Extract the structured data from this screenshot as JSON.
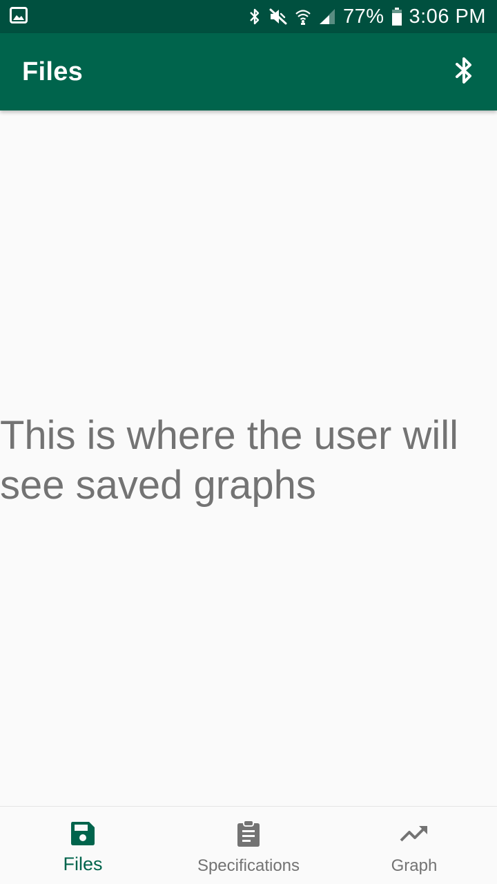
{
  "status_bar": {
    "battery_percent": "77%",
    "time": "3:06 PM",
    "icons": [
      "image-icon",
      "bluetooth-icon",
      "mute-icon",
      "wifi-icon",
      "signal-icon",
      "battery-icon"
    ]
  },
  "app_bar": {
    "title": "Files",
    "action_icon": "bluetooth-icon"
  },
  "main": {
    "placeholder": "This is where the user will see saved graphs"
  },
  "bottom_nav": {
    "items": [
      {
        "label": "Files",
        "icon": "save-icon",
        "active": true
      },
      {
        "label": "Specifications",
        "icon": "clipboard-icon",
        "active": false
      },
      {
        "label": "Graph",
        "icon": "trending-up-icon",
        "active": false
      }
    ]
  },
  "colors": {
    "status_bar": "#00503f",
    "app_bar": "#00644c",
    "accent": "#00644c",
    "inactive": "#737373",
    "background": "#fafafa"
  }
}
